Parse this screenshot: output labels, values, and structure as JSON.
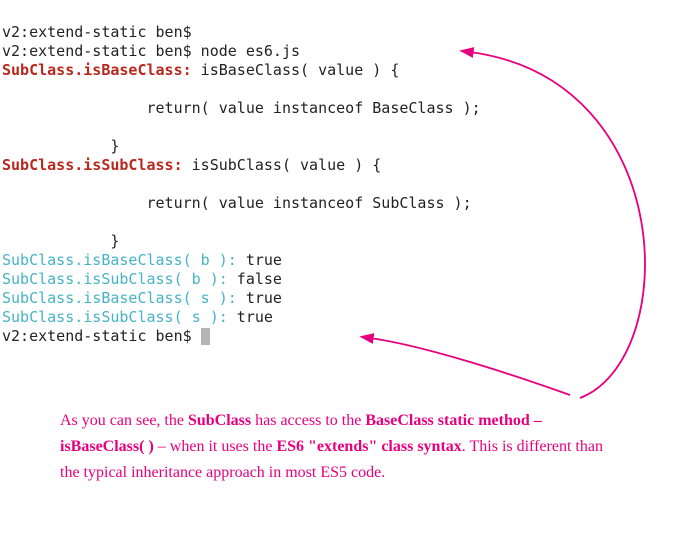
{
  "terminal": {
    "prompt1": "v2:extend-static ben$",
    "prompt2": "v2:extend-static ben$ node es6.js",
    "line1a": "SubClass.isBaseClass:",
    "line1b": " isBaseClass( value ) {",
    "line2": "                return( value instanceof BaseClass );",
    "line3": "            }",
    "line4a": "SubClass.isSubClass:",
    "line4b": " isSubClass( value ) {",
    "line5": "                return( value instanceof SubClass );",
    "line6": "            }",
    "call1a": "SubClass.isBaseClass( b ):",
    "call1b": " true",
    "call2a": "SubClass.isSubClass( b ):",
    "call2b": " false",
    "call3a": "SubClass.isBaseClass( s ):",
    "call3b": " true",
    "call4a": "SubClass.isSubClass( s ):",
    "call4b": " true",
    "prompt3": "v2:extend-static ben$ "
  },
  "annotation": {
    "t1": "As you can see, the ",
    "t2": "SubClass",
    "t3": " has access to the ",
    "t4": "BaseClass static method – isBaseClass( )",
    "t5": "  – when it uses the ",
    "t6": "ES6 \"extends\" class syntax",
    "t7": ". This is different than the typical inheritance approach in most ES5 code."
  },
  "colors": {
    "arrow": "#e6007e"
  }
}
